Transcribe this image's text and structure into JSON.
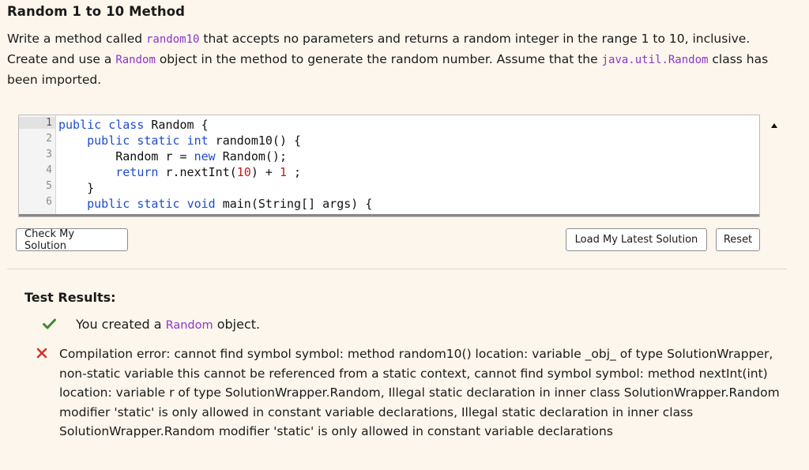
{
  "problem": {
    "title": "Random 1 to 10 Method",
    "desc_parts": [
      "Write a method called ",
      "random10",
      " that accepts no parameters and returns a random integer in the range 1 to 10, inclusive. Create and use a ",
      "Random",
      " object in the method to generate the random number. Assume that the ",
      "java.util.Random",
      " class has been imported."
    ]
  },
  "editor": {
    "line_numbers": [
      "1",
      "2",
      "3",
      "4",
      "5",
      "6"
    ],
    "lines": [
      {
        "indent": "",
        "tokens": [
          {
            "t": "public",
            "k": "kw"
          },
          {
            "t": " "
          },
          {
            "t": "class",
            "k": "kw"
          },
          {
            "t": " Random {"
          }
        ]
      },
      {
        "indent": "    ",
        "tokens": [
          {
            "t": "public",
            "k": "kw"
          },
          {
            "t": " "
          },
          {
            "t": "static",
            "k": "kw"
          },
          {
            "t": " "
          },
          {
            "t": "int",
            "k": "kw"
          },
          {
            "t": " random10() {"
          }
        ]
      },
      {
        "indent": "        ",
        "tokens": [
          {
            "t": "Random r = "
          },
          {
            "t": "new",
            "k": "kw"
          },
          {
            "t": " Random();"
          }
        ]
      },
      {
        "indent": "        ",
        "tokens": [
          {
            "t": "return",
            "k": "kw"
          },
          {
            "t": " r.nextInt("
          },
          {
            "t": "10",
            "k": "num"
          },
          {
            "t": ") + "
          },
          {
            "t": "1",
            "k": "num"
          },
          {
            "t": " ;"
          }
        ]
      },
      {
        "indent": "    ",
        "tokens": [
          {
            "t": "}"
          }
        ]
      },
      {
        "indent": "    ",
        "tokens": [
          {
            "t": "public",
            "k": "kw"
          },
          {
            "t": " "
          },
          {
            "t": "static",
            "k": "kw"
          },
          {
            "t": " "
          },
          {
            "t": "void",
            "k": "kw"
          },
          {
            "t": " main(String[] args) {"
          }
        ]
      }
    ]
  },
  "buttons": {
    "check": "Check My Solution",
    "load": "Load My Latest Solution",
    "reset": "Reset"
  },
  "results": {
    "title": "Test Results:",
    "passed": {
      "prefix": "You created a ",
      "code": "Random",
      "suffix": " object."
    },
    "error": "Compilation error: cannot find symbol symbol: method random10() location: variable _obj_ of type SolutionWrapper, non-static variable this cannot be referenced from a static context, cannot find symbol symbol: method nextInt(int) location: variable r of type SolutionWrapper.Random, Illegal static declaration in inner class SolutionWrapper.Random modifier 'static' is only allowed in constant variable declarations, Illegal static declaration in inner class SolutionWrapper.Random modifier 'static' is only allowed in constant variable declarations"
  },
  "colors": {
    "background": "#fdf6ec",
    "code_identifier": "#8a36c8",
    "keyword": "#1f4ccf",
    "number": "#c41a16",
    "pass_check": "#3b8a2e",
    "fail_x": "#d0342c"
  },
  "icons": {
    "pass": "check-icon",
    "fail": "x-icon",
    "scroll": "scroll-up-arrow-icon"
  }
}
